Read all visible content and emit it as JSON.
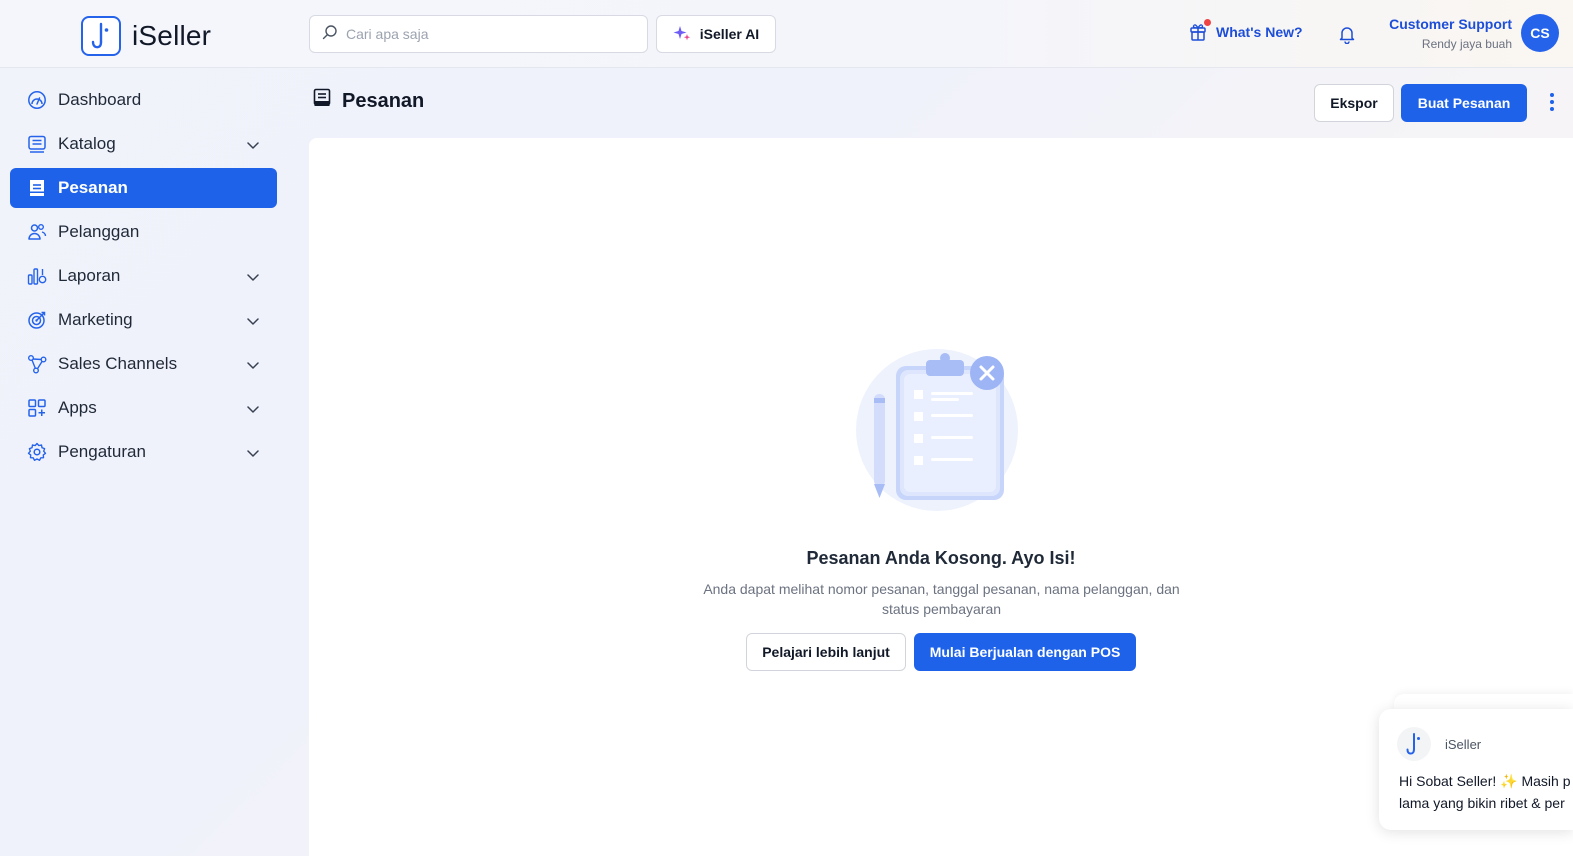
{
  "app": {
    "name": "iSeller"
  },
  "header": {
    "search_placeholder": "Cari apa saja",
    "ai_button": "iSeller AI",
    "whats_new": "What's New?",
    "user_name": "Customer Support",
    "user_store": "Rendy jaya buah",
    "avatar_initials": "CS"
  },
  "sidebar": {
    "items": [
      {
        "label": "Dashboard",
        "icon": "dashboard-icon",
        "chevron": false,
        "active": false
      },
      {
        "label": "Katalog",
        "icon": "catalog-icon",
        "chevron": true,
        "active": false
      },
      {
        "label": "Pesanan",
        "icon": "orders-icon",
        "chevron": false,
        "active": true
      },
      {
        "label": "Pelanggan",
        "icon": "customers-icon",
        "chevron": false,
        "active": false
      },
      {
        "label": "Laporan",
        "icon": "reports-icon",
        "chevron": true,
        "active": false
      },
      {
        "label": "Marketing",
        "icon": "target-icon",
        "chevron": true,
        "active": false
      },
      {
        "label": "Sales Channels",
        "icon": "channels-icon",
        "chevron": true,
        "active": false
      },
      {
        "label": "Apps",
        "icon": "apps-icon",
        "chevron": true,
        "active": false
      },
      {
        "label": "Pengaturan",
        "icon": "gear-icon",
        "chevron": true,
        "active": false
      }
    ]
  },
  "page": {
    "title": "Pesanan",
    "export_button": "Ekspor",
    "create_button": "Buat Pesanan"
  },
  "empty_state": {
    "title": "Pesanan Anda Kosong. Ayo Isi!",
    "description": "Anda dapat melihat nomor pesanan, tanggal pesanan, nama pelanggan, dan status pembayaran",
    "learn_button": "Pelajari lebih lanjut",
    "pos_button": "Mulai Berjualan dengan POS"
  },
  "chat": {
    "sender": "iSeller",
    "message_line1": "Hi Sobat Seller! ✨ Masih p",
    "message_line2": "lama yang bikin ribet & per"
  },
  "colors": {
    "primary": "#1e62ea",
    "link": "#1d4ed8",
    "notification": "#ef4444"
  }
}
